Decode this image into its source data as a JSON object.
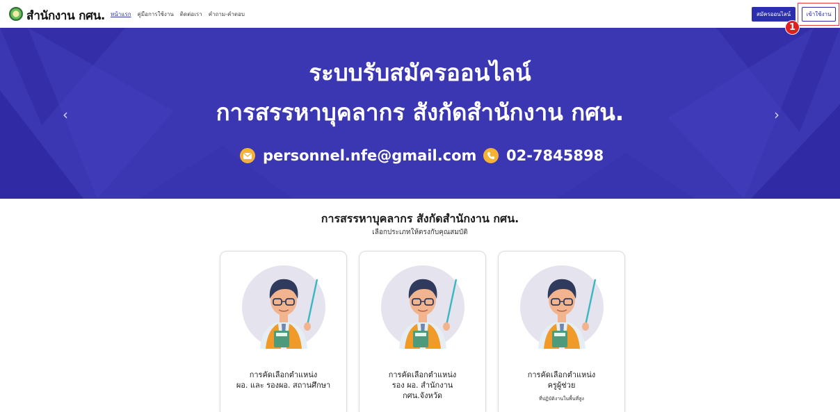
{
  "navbar": {
    "logo_icon": "ministry-seal-icon",
    "brand": "สำนักงาน กศน.",
    "links": [
      "หน้าแรก",
      "คู่มือการใช้งาน",
      "ติดต่อเรา",
      "คำถาม-คำตอบ"
    ],
    "active_link": "หน้าแรก",
    "register_button": "สมัครออนไลน์",
    "login_button": "เข้าใช้งาน",
    "step_badge": "1",
    "accent_color": "#2b2eae",
    "highlight_color": "#e23c3c"
  },
  "banner": {
    "line1": "ระบบรับสมัครออนไลน์",
    "line2": "การสรรหาบุคลากร สังกัดสำนักงาน กศน.",
    "email": "personnel.nfe@gmail.com",
    "phone": "02-7845898",
    "prev_arrow": "‹",
    "next_arrow": "›",
    "background_color": "#3b36b2"
  },
  "section": {
    "title": "การสรรหาบุคลากร สังกัดสำนักงาน กศน.",
    "subtitle": "เลือกประเภทให้ตรงกับคุณสมบัติ"
  },
  "cards": [
    {
      "title_line1": "การคัดเลือกตำแหน่ง",
      "title_line2": "ผอ. และ รองผอ. สถานศึกษา",
      "title_line3": "",
      "note": ""
    },
    {
      "title_line1": "การคัดเลือกตำแหน่ง",
      "title_line2": "รอง ผอ. สำนักงาน",
      "title_line3": "กศน.จังหวัด",
      "note": ""
    },
    {
      "title_line1": "การคัดเลือกตำแหน่ง",
      "title_line2": "ครูผู้ช่วย",
      "title_line3": "",
      "note": "ที่ปฏิบัติงานในพื้นที่สูง"
    }
  ]
}
